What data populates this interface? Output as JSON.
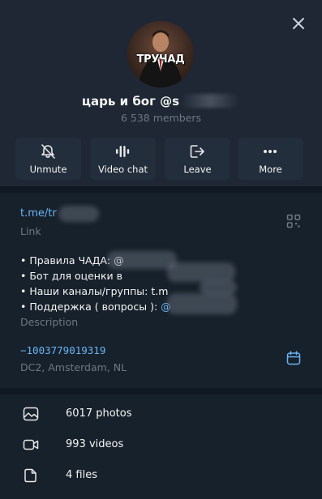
{
  "header": {
    "avatar_text": "ТРУЧАД",
    "title": "царь и бог @s",
    "members": "6 538 members"
  },
  "actions": [
    {
      "label": "Unmute",
      "icon": "bell-off-icon"
    },
    {
      "label": "Video chat",
      "icon": "video-chat-icon"
    },
    {
      "label": "Leave",
      "icon": "leave-icon"
    },
    {
      "label": "More",
      "icon": "more-icon"
    }
  ],
  "info": {
    "link": "t.me/tr",
    "link_caption": "Link",
    "description_lines": [
      "• Правила ЧАДА: @",
      "• Бот для оценки в",
      "• Наши каналы/группы: t.m",
      "• Поддержка ( вопросы ): "
    ],
    "description_mention": "@",
    "description_caption": "Description",
    "chat_id": "−1003779019319",
    "datacenter": "DC2, Amsterdam, NL"
  },
  "media": [
    {
      "label": "6017 photos",
      "icon": "photo-icon"
    },
    {
      "label": "993 videos",
      "icon": "video-icon"
    },
    {
      "label": "4 files",
      "icon": "file-icon"
    }
  ],
  "colors": {
    "background": "#17212b",
    "header_bg": "#1e2733",
    "accent": "#6ab3f3",
    "muted": "#6d7883"
  }
}
